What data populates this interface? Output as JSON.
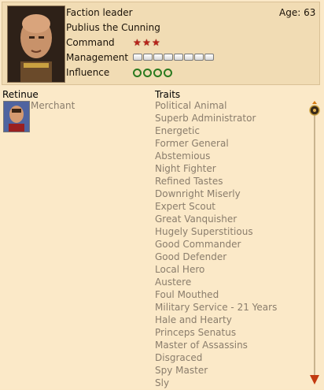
{
  "leader": {
    "title": "Faction leader",
    "name": "Publius the Cunning",
    "age": "Age: 63",
    "command_label": "Command",
    "management_label": "Management",
    "influence_label": "Influence",
    "command_value": 3,
    "management_value": 8,
    "influence_value": 4
  },
  "retinue": {
    "heading": "Retinue",
    "items": [
      {
        "label": "Merchant"
      }
    ]
  },
  "traits": {
    "heading": "Traits",
    "items": [
      "Political Animal",
      "Superb Administrator",
      "Energetic",
      "Former General",
      "Abstemious",
      "Night Fighter",
      "Refined Tastes",
      "Downright Miserly",
      "Expert Scout",
      "Great Vanquisher",
      "Hugely Superstitious",
      "Good Commander",
      "Good Defender",
      "Local Hero",
      "Austere",
      "Foul Mouthed",
      "Military Service - 21 Years",
      "Hale and Hearty",
      "Princeps Senatus",
      "Master of Assassins",
      "Disgraced",
      "Spy Master",
      "Sly"
    ]
  },
  "colors": {
    "background": "#fbe9c8",
    "command_star": "#b8231a",
    "influence_laurel": "#2b7a20",
    "muted_text": "#8a7d6c"
  }
}
